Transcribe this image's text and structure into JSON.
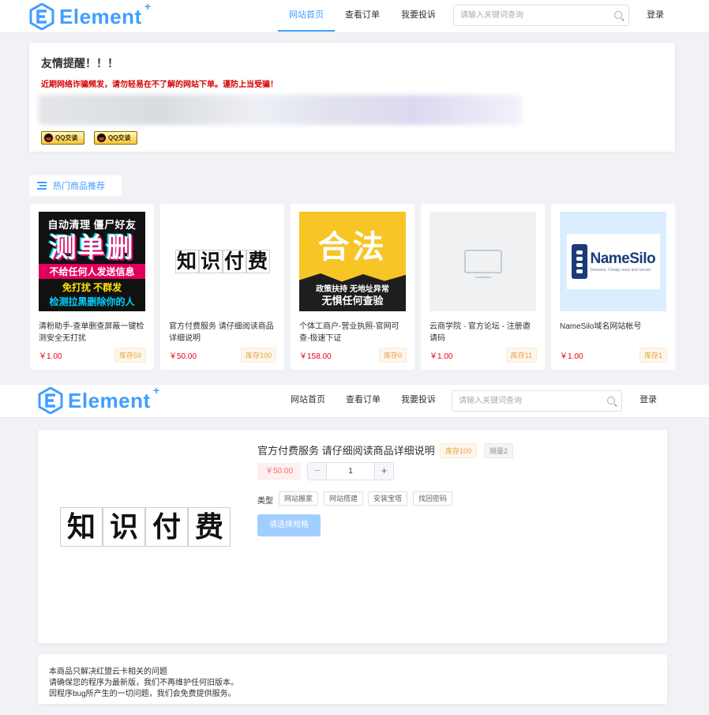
{
  "brand": {
    "name": "Element",
    "plus": "+",
    "color": "#409eff"
  },
  "nav": {
    "items": [
      "网站首页",
      "查看订单",
      "我要投诉"
    ],
    "search_placeholder": "请输入关键词查询",
    "login": "登录"
  },
  "notice": {
    "title": "友情提醒！！！",
    "text": "近期网络诈骗频发，请勿轻易在不了解的网站下单。谨防上当受骗！",
    "qq_buttons": [
      "QQ交谈",
      "QQ交谈"
    ]
  },
  "hot": {
    "label": "热门商品推荐",
    "products": [
      {
        "name": "清粉助手-查单删查屏蔽一键检测安全无打扰",
        "price": "￥1.00",
        "stock": "库存59",
        "image_text": {
          "l1": "自动清理 僵尸好友",
          "big": "测单删",
          "l2": "不给任何人发送信息",
          "l3": "免打扰 不群发",
          "l4": "检测拉黑删除你的人"
        }
      },
      {
        "name": "官方付费服务 请仔细阅读商品详细说明",
        "price": "￥50.00",
        "stock": "库存100",
        "image_text": {
          "chars": [
            "知",
            "识",
            "付",
            "费"
          ]
        }
      },
      {
        "name": "个体工商户-营业执照-官网可查-极速下证",
        "price": "￥158.00",
        "stock": "库存0",
        "image_text": {
          "big": "合法",
          "t1": "政策扶持 无地址异常",
          "t2": "无惧任何查验"
        }
      },
      {
        "name": "云商学院 - 官方论坛 - 注册邀请码",
        "price": "￥1.00",
        "stock": "库存11",
        "image_text": {}
      },
      {
        "name": "NameSilo域名网站帐号",
        "price": "￥1.00",
        "stock": "库存1",
        "image_text": {
          "brand": "NameSilo",
          "tagline": "Domains. Cheap, easy and secure"
        }
      }
    ]
  },
  "detail": {
    "title": "官方付费服务 请仔细阅读商品详细说明",
    "stock_tag": "库存100",
    "sales_tag": "销量2",
    "price": "￥50.00",
    "quantity": "1",
    "minus": "−",
    "plus": "+",
    "type_label": "类型",
    "options": [
      "网站搬家",
      "网站搭建",
      "安装宝塔",
      "找回密码"
    ],
    "spec_button": "请选择规格",
    "image_chars": [
      "知",
      "识",
      "付",
      "费"
    ]
  },
  "info": {
    "lines": [
      "本商品只解决红盟云卡相关的问题",
      "请确保您的程序为最新版，我们不再维护任何旧版本。",
      "因程序bug所产生的一切问题，我们会免费提供服务。"
    ]
  }
}
